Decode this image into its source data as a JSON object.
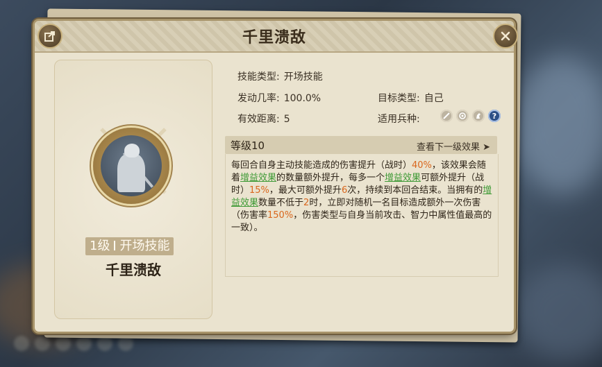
{
  "window": {
    "title": "千里溃敌",
    "share_icon": "share-icon",
    "close_icon": "close-icon"
  },
  "skill_card": {
    "level": "1级",
    "type": "开场技能",
    "name": "千里溃敌"
  },
  "info": {
    "skill_type_label": "技能类型:",
    "skill_type_value": "开场技能",
    "trigger_rate_label": "发动几率:",
    "trigger_rate_value": "100.0%",
    "target_type_label": "目标类型:",
    "target_type_value": "自己",
    "range_label": "有效距离:",
    "range_value": "5",
    "troop_label": "适用兵种:",
    "troop_icons": [
      "sword-icon",
      "bow-icon",
      "horse-icon",
      "question-icon"
    ],
    "help_glyph": "?"
  },
  "level_bar": {
    "level": "等级10",
    "next_level_link": "查看下一级效果 ➤"
  },
  "description": {
    "p1": "每回合自身主动技能造成的伤害提升（战时）",
    "v1": "40%",
    "p2": "，该效果会随着",
    "buff1": "增益效果",
    "p3": "的数量额外提升，每多一个",
    "buff2": "增益效果",
    "p4": "可额外提升（战时）",
    "v2": "15%",
    "p5": "，最大可额外提升",
    "v3": "6",
    "p6": "次，持续到本回合结束。当拥有的",
    "buff3": "增益效果",
    "p7": "数量不低于",
    "v4": "2",
    "p8": "时，立即对随机一名目标造成额外一次伤害（伤害率",
    "v5": "150%",
    "p9": "，伤害类型与自身当前攻击、智力中属性值最高的一致）。"
  },
  "colors": {
    "highlight": "#d9661c",
    "buff": "#3f9a36",
    "panel": "#eae3cf",
    "title_text": "#3a2d1c"
  }
}
